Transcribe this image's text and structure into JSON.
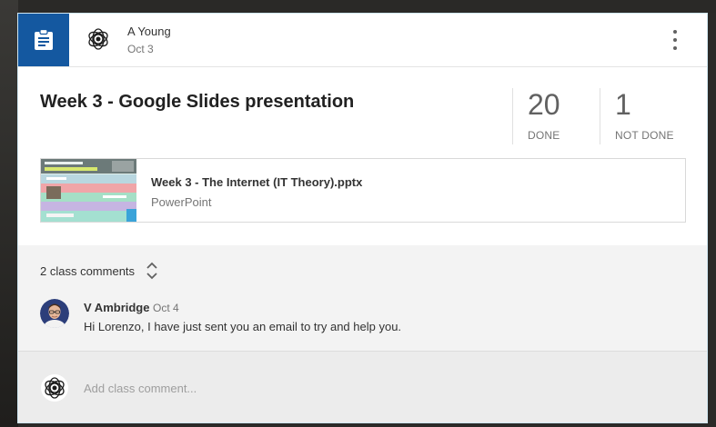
{
  "post": {
    "type_icon": "assignment-icon",
    "author_name": "A Young",
    "date": "Oct 3",
    "title": "Week 3 - Google Slides presentation",
    "menu_icon": "more-vertical-icon"
  },
  "stats": {
    "done_count": "20",
    "done_label": "DONE",
    "not_done_count": "1",
    "not_done_label": "NOT DONE"
  },
  "attachment": {
    "name": "Week 3 - The Internet (IT Theory).pptx",
    "file_type": "PowerPoint"
  },
  "comments": {
    "count_label": "2 class comments",
    "items": [
      {
        "author": "V Ambridge",
        "date": "Oct 4",
        "text": "Hi Lorenzo, I have just sent you an email to try and help you."
      }
    ]
  },
  "add_comment": {
    "placeholder": "Add class comment..."
  },
  "colors": {
    "type_tile": "#1458a0",
    "card_border": "#cfe6f1",
    "comments_bg": "#f3f3f3"
  }
}
